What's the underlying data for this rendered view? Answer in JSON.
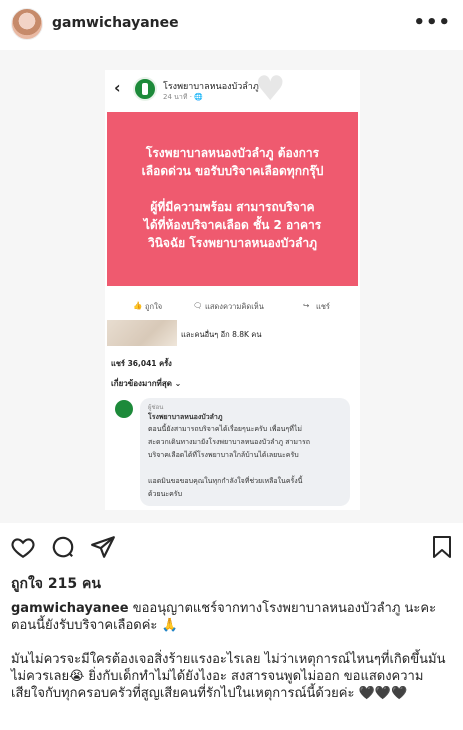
{
  "post": {
    "username": "gamwichayanee",
    "likes": "ถูกใจ 215 คน",
    "caption_first": "ขออนุญาตแชร์จากทางโรงพยาบาลหนองบัวลำภู นะคะ ตอนนี้ยังรับบริจาคเลือดค่ะ 🙏",
    "caption_second": "มันไม่ควรจะมีใครต้องเจอสิ่งร้ายแรงอะไรเลย ไม่ว่าเหตุการณ์ไหนๆที่เกิดขึ้นมันไม่ควรเลย😭 ยิ่งกับเด็กทำไม่ได้ยังไงอะ สงสารจนพูดไม่ออก ขอแสดงความเสียใจกับทุกครอบครัวที่สูญเสียคนที่รักไปในเหตุการณ์นี้ด้วยค่ะ 🖤🖤🖤"
  },
  "shot": {
    "page_name": "โรงพยาบาลหนองบัวลำภู",
    "time": "24 นาที · 🌐",
    "pink_lines": [
      "โรงพยาบาลหนองบัวลำภู ต้องการ",
      "เลือดด่วน ขอรับบริจาคเลือดทุกกรุ๊ป",
      "ผู้ที่มีความพร้อม สามารถบริจาค",
      "ได้ที่ห้องบริจาคเลือด ชั้น 2 อาคาร",
      "วินิจฉัย โรงพยาบาลหนองบัวลำภู"
    ],
    "like_label": "ถูกใจ",
    "comment_label": "แสดงความคิดเห็น",
    "share_label": "แชร์",
    "reactions": "และคนอื่นๆ อีก 8.8K คน",
    "shares": "แชร์ 36,041 ครั้ง",
    "relevant": "เกี่ยวข้องมากที่สุด ⌄",
    "comment_badge": "ผู้ช่อน",
    "comment_name": "โรงพยาบาลหนองบัวลำภู",
    "comment_lines": [
      "ตอนนี้ยังสามารถบริจาคได้เรื่อยๆนะครับ เพื่อนๆที่ไม่",
      "สะดวกเดินทางมายังโรงพยาบาลหนองบัวลำภู สามารถ",
      "บริจาคเลือดได้ที่โรงพยาบาลใกล้บ้านได้เลยนะครับ",
      "",
      "แอดมินขอขอบคุณในทุกกำลังใจที่ช่วยเหลือในครั้งนี้",
      "ด้วยนะครับ"
    ]
  },
  "icons": [
    "heart-icon",
    "comment-icon",
    "share-icon",
    "bookmark-icon",
    "more-icon"
  ]
}
